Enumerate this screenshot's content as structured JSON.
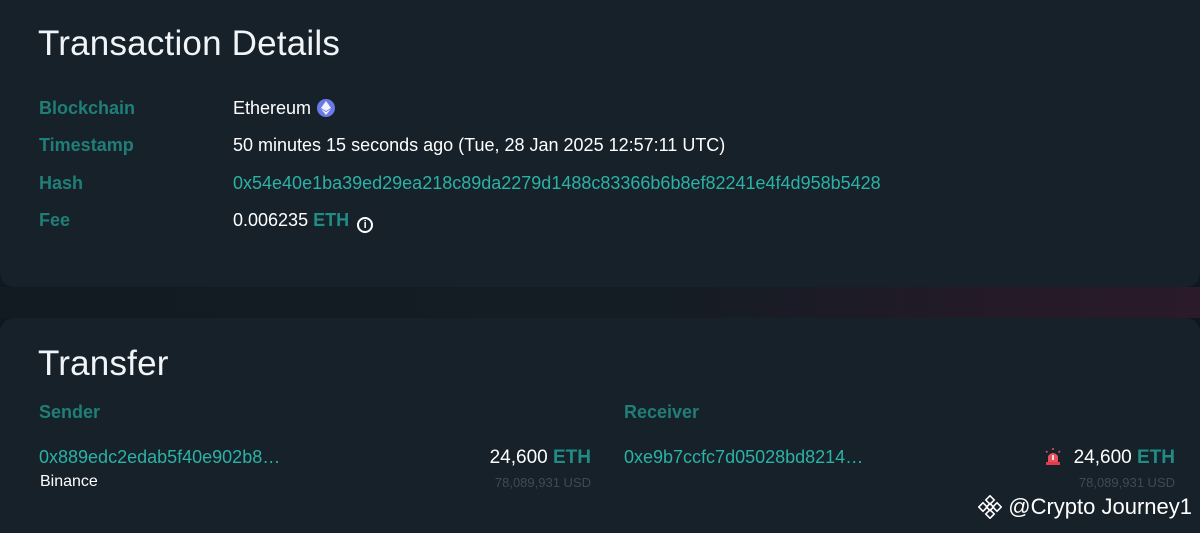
{
  "details": {
    "title": "Transaction Details",
    "blockchain_label": "Blockchain",
    "blockchain_value": "Ethereum",
    "timestamp_label": "Timestamp",
    "timestamp_value": "50 minutes 15 seconds ago (Tue, 28 Jan 2025 12:57:11 UTC)",
    "hash_label": "Hash",
    "hash_value": "0x54e40e1ba39ed29ea218c89da2279d1488c83366b6b8ef82241e4f4d958b5428",
    "fee_label": "Fee",
    "fee_amount": "0.006235",
    "fee_currency": "ETH"
  },
  "transfer": {
    "title": "Transfer",
    "sender": {
      "label": "Sender",
      "address": "0x889edc2edab5f40e902b8…",
      "entity": "Binance",
      "amount": "24,600",
      "currency": "ETH",
      "usd": "78,089,931 USD"
    },
    "receiver": {
      "label": "Receiver",
      "address": "0xe9b7ccfc7d05028bd8214…",
      "amount": "24,600",
      "currency": "ETH",
      "usd": "78,089,931 USD"
    }
  },
  "watermark": "@Crypto Journey1",
  "colors": {
    "background": "#17212a",
    "label": "#1f7f78",
    "link": "#2bb2a6",
    "eth_icon": "#6a79e8"
  },
  "icons": [
    "ethereum-icon",
    "info-icon",
    "alarm-icon",
    "binance-logo-icon"
  ]
}
